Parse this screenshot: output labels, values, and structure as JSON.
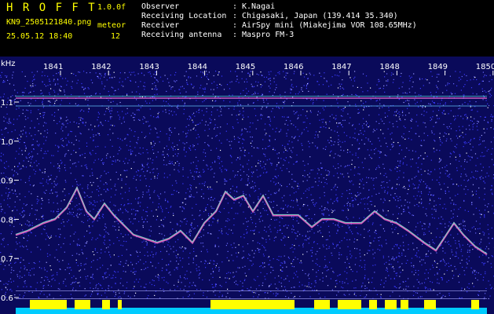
{
  "header": {
    "app_title": "H R O F F T",
    "version": "1.0.0f",
    "filename": "KN9_2505121840.png",
    "datetime": "25.05.12 18:40",
    "meteor_label": "meteor",
    "meteor_count": "12",
    "info": [
      {
        "label": "Observer",
        "sep": ":",
        "value": "K.Nagai"
      },
      {
        "label": "Receiving Location",
        "sep": ":",
        "value": "Chigasaki, Japan (139.414 35.340)"
      },
      {
        "label": "Receiver",
        "sep": ":",
        "value": "AirSpy mini (Miakejima VOR 108.65MHz)"
      },
      {
        "label": "Receiving antenna",
        "sep": ":",
        "value": "Maspro FM-3"
      }
    ]
  },
  "axis": {
    "y_unit": "kHz",
    "y_ticks": [
      "1.1",
      "1.0",
      "0.9",
      "0.8",
      "0.7",
      "0.6"
    ],
    "x_ticks": [
      "1841",
      "1842",
      "1843",
      "1844",
      "1845",
      "1846",
      "1847",
      "1848",
      "1849",
      "1850"
    ]
  },
  "colors": {
    "background": "#0a0a5a",
    "noise": "#3a3aff",
    "trace": "#ff66cc",
    "trace2": "#66ffcc",
    "meteor_bar": "#ffff00",
    "baseline": "#00ccff",
    "text_yellow": "#ffff00",
    "text_white": "#ffffff"
  }
}
